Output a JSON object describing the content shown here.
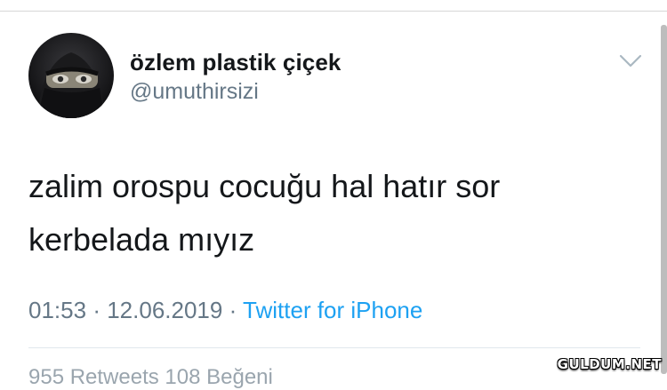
{
  "tweet": {
    "display_name": "özlem plastik çiçek",
    "handle": "@umuthirsizi",
    "text_line1": "zalim orospu cocuğu hal hatır sor",
    "text_line2": "kerbelada mıyız",
    "time": "01:53",
    "separator": "·",
    "date": "12.06.2019",
    "source": "Twitter for iPhone",
    "stats_peek": "955 Retweets 108 Beğeni"
  },
  "icons": {
    "menu": "chevron-down-icon",
    "avatar": "avatar"
  },
  "watermark": "GULDUM.NET",
  "colors": {
    "name": "#14171a",
    "secondary": "#657786",
    "link": "#1da1f2"
  }
}
